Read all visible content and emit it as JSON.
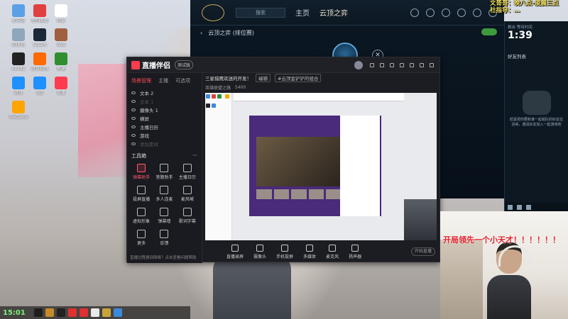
{
  "desktop": {
    "icons": [
      {
        "label": "此电脑",
        "color": "#5aa0e6"
      },
      {
        "label": "控制面板",
        "color": "#e04040"
      },
      {
        "label": "网易",
        "color": "#ffffff"
      },
      {
        "label": "回收站",
        "color": "#8fa7bb"
      },
      {
        "label": "Steam",
        "color": "#1b2838"
      },
      {
        "label": "Wall",
        "color": "#a06040"
      },
      {
        "label": "Kindle",
        "color": "#222222"
      },
      {
        "label": "腾讯视频",
        "color": "#ff6a00"
      },
      {
        "label": "新建",
        "color": "#2f8f2f"
      },
      {
        "label": "腾讯",
        "color": "#1e90ff"
      },
      {
        "label": "QQ",
        "color": "#1e90ff"
      },
      {
        "label": "直播",
        "color": "#ff3c4f"
      },
      {
        "label": "WeGame",
        "color": "#ffa500"
      }
    ]
  },
  "taskbar": {
    "clock": "15:01"
  },
  "game": {
    "search_placeholder": "搜索",
    "nav_home": "主页",
    "nav_mode": "云顶之弈",
    "mode_title": "云顶之弈 (排位赛)"
  },
  "overlay": {
    "line1": "文哥哥：晚八点-凌晨三点",
    "line2": "社指导：…"
  },
  "stream_assistant": {
    "app_name": "直播伴侣",
    "version_badge": "测试版",
    "tabs": [
      "场景管理",
      "主播",
      "可选项"
    ],
    "scenes": [
      "文本 2",
      "文本 1",
      "摄像头 1",
      "横屏",
      "主播日历",
      "游戏",
      "添加素材"
    ],
    "tools_header": "工具箱",
    "tools": [
      "弹幕助手",
      "答题助手",
      "主播日历",
      "投屏直播",
      "多人连麦",
      "麦风喊",
      "虚拟形象",
      "弹幕墙",
      "歌词字幕",
      "更多",
      "反馈"
    ],
    "title_text": "三星猎鹰欢送的开发！",
    "edit_label": "编辑",
    "tag_label": "#云顶金铲铲的组合",
    "info_game": "英雄联盟之路",
    "info_mode": "5400",
    "bottom_items": [
      "直播录屏",
      "摄像头",
      "手机投屏",
      "多媒体",
      "麦克风",
      "扬声器"
    ],
    "start_button": "开始直播",
    "tip": "直播过程遇到网络？点击查看问题帮助"
  },
  "side_panel": {
    "timer_label": "剩余 等待时间",
    "timer": "1:39",
    "friends_header": "好友列表",
    "description": "赶紧把你要和谁一起组队的好友拉进来，邀请好友加入一起游戏吧"
  },
  "webcam": {
    "caption": "开局领先一个小天才！！！！！！"
  }
}
